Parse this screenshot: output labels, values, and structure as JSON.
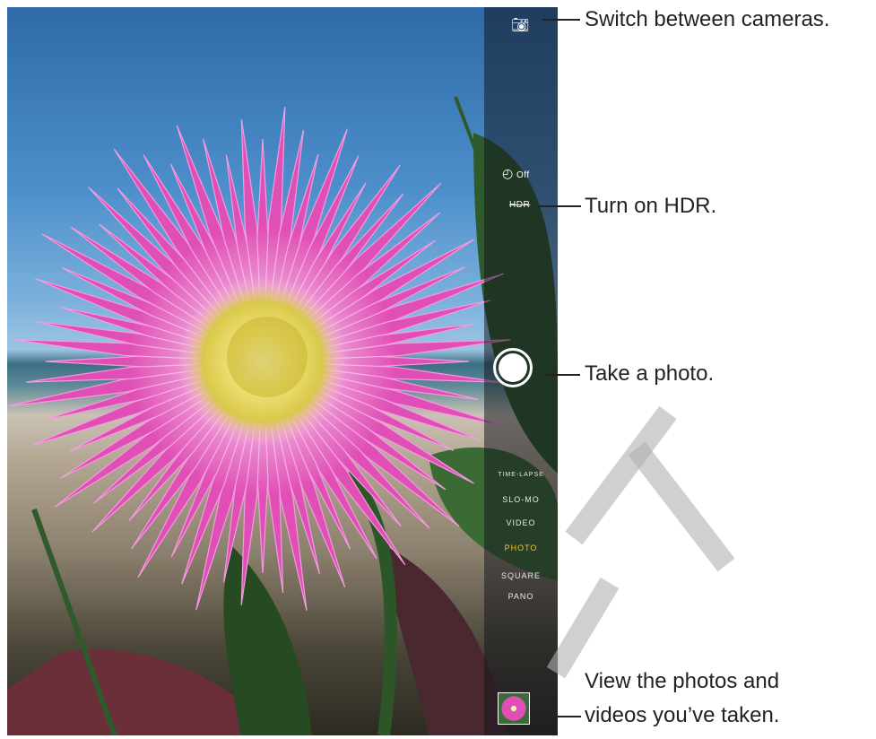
{
  "camera": {
    "timer_label": "Off",
    "hdr_label": "HDR",
    "modes": [
      "TIME-LAPSE",
      "SLO-MO",
      "VIDEO",
      "PHOTO",
      "SQUARE",
      "PANO"
    ],
    "active_mode": "PHOTO",
    "colors": {
      "active_mode": "#f4c520",
      "flower": "#e04fb5"
    }
  },
  "callouts": {
    "switch_camera": "Switch between cameras.",
    "hdr": "Turn on HDR.",
    "shutter": "Take a photo.",
    "gallery_line1": "View the photos and",
    "gallery_line2": "videos you’ve taken."
  }
}
